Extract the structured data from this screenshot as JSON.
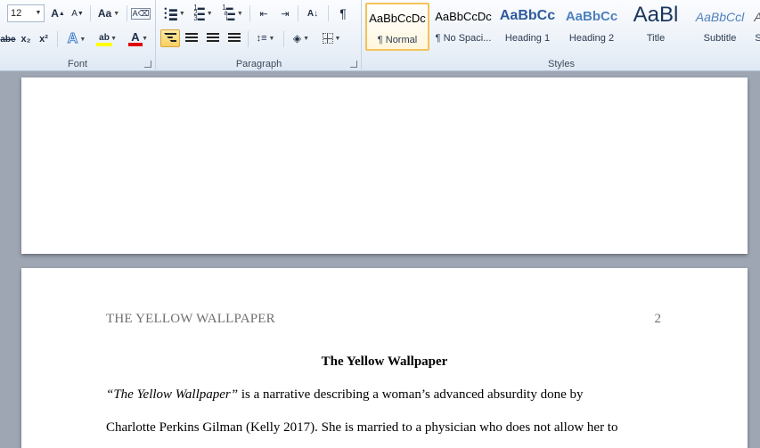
{
  "ribbon": {
    "font_group": {
      "label": "Font",
      "font_size": "12",
      "grow_font": "A",
      "shrink_font": "A",
      "change_case": "Aa",
      "strikethrough": "abe",
      "subscript": "x₂",
      "superscript": "x²",
      "text_effects": "A",
      "highlight": "ab",
      "font_color": "A"
    },
    "paragraph_group": {
      "label": "Paragraph",
      "pilcrow": "¶"
    },
    "styles_group": {
      "label": "Styles",
      "tiles": [
        {
          "sample": "AaBbCcDc",
          "name": "¶ Normal"
        },
        {
          "sample": "AaBbCcDc",
          "name": "¶ No Spaci..."
        },
        {
          "sample": "AaBbCc",
          "name": "Heading 1"
        },
        {
          "sample": "AaBbCc",
          "name": "Heading 2"
        },
        {
          "sample": "AaBl",
          "name": "Title"
        },
        {
          "sample": "AaBbCcl",
          "name": "Subtitle"
        },
        {
          "sample": "A",
          "name": "S"
        }
      ]
    },
    "colors": {
      "highlight_bar": "#ffff00",
      "font_color_bar": "#e00000",
      "heading_blue": "#2e5a9a"
    }
  },
  "document": {
    "running_head": "THE YELLOW WALLPAPER",
    "page_number": "2",
    "title": "The Yellow Wallpaper",
    "line1_italic": "“The Yellow Wallpaper”",
    "line1_rest": " is a narrative describing a woman’s advanced absurdity done by",
    "line2": "Charlotte Perkins Gilman (Kelly 2017). She is married to a physician who does not allow her to"
  }
}
